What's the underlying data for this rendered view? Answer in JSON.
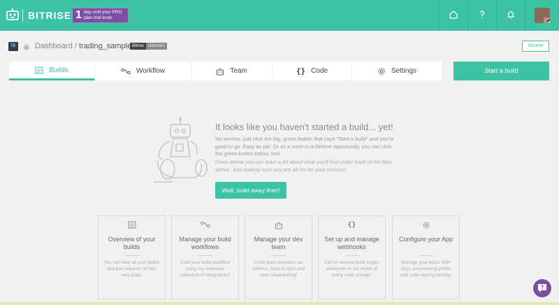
{
  "header": {
    "brand": "BITRISE",
    "trial_number": "1",
    "trial_text": "day until your PRO plan trial ends"
  },
  "breadcrumb": {
    "project_initials": "TE",
    "dashboard": "Dashboard",
    "separator": "/",
    "app_name": "trading_sample",
    "stack_label": "Bitrise",
    "stack_value": "unknown"
  },
  "source_button": "Source",
  "tabs": [
    {
      "label": "Builds",
      "icon": "builds-icon",
      "active": true
    },
    {
      "label": "Workflow",
      "icon": "workflow-icon"
    },
    {
      "label": "Team",
      "icon": "robot-icon"
    },
    {
      "label": "Code",
      "icon": "code-braces-icon"
    },
    {
      "label": "Settings",
      "icon": "gear-icon"
    }
  ],
  "start_build_button": "Start a build",
  "empty_state": {
    "title": "It looks like you haven't started a build... yet!",
    "paragraph1": "No worries, just click the big, green button that says \"Start a build\" and you're good to go. Easy as pie. Or as a once-in-a-lifetime opportunity, you can click the green button below, too!",
    "paragraph2": "Down below you can learn a bit about what you'll find under each of the tabs above. Just making sure you are all set for your mission!",
    "button": "Well, build away then!"
  },
  "cards": [
    {
      "title": "Overview of your builds",
      "desc": "You can view all your builds and pull requests on this very page."
    },
    {
      "title": "Manage your build workflows",
      "desc": "Craft your build workflow using our extensive collection of integrations!"
    },
    {
      "title": "Manage your dev team",
      "desc": "Invite team members as Admins, Devs or QAs and start collaborating!"
    },
    {
      "title": "Set up and manage webhooks",
      "desc": "Add or remove build trigger webhooks to run builds at every code change."
    },
    {
      "title": "Configure your App",
      "desc": "Manage your App's SSH keys, provisioning profile and code signing identity."
    }
  ],
  "colors": {
    "accent": "#3bc3a3",
    "trial_badge": "#7b4fa4",
    "help_button": "#7b4fa4"
  }
}
